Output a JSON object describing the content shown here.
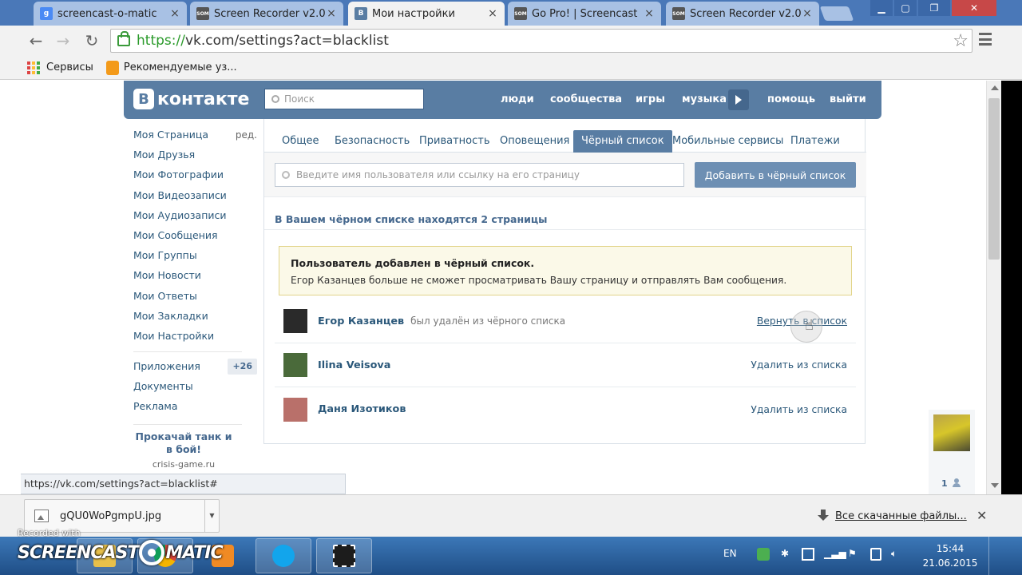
{
  "browser": {
    "tabs": [
      {
        "title": "screencast-o-matic",
        "favicon_color": "#4a8af4",
        "favicon_text": "g"
      },
      {
        "title": "Screen Recorder v2.0",
        "favicon_color": "#555555",
        "favicon_text": "SOM"
      },
      {
        "title": "Мои настройки",
        "favicon_color": "#597da3",
        "favicon_text": "B"
      },
      {
        "title": "Go Pro! | Screencast",
        "favicon_color": "#555555",
        "favicon_text": "SOM"
      },
      {
        "title": "Screen Recorder v2.0",
        "favicon_color": "#555555",
        "favicon_text": "SOM"
      }
    ],
    "url_scheme": "https://",
    "url_rest": "vk.com/settings?act=blacklist",
    "bookmarks": [
      "Сервисы",
      "Рекомендуемые уз..."
    ],
    "status_url": "https://vk.com/settings?act=blacklist#"
  },
  "vk": {
    "logo_text": "контакте",
    "search_placeholder": "Поиск",
    "nav": [
      "люди",
      "сообщества",
      "игры",
      "музыка",
      "помощь",
      "выйти"
    ],
    "left_menu": [
      "Моя Страница",
      "Мои Друзья",
      "Мои Фотографии",
      "Мои Видеозаписи",
      "Мои Аудиозаписи",
      "Мои Сообщения",
      "Мои Группы",
      "Мои Новости",
      "Мои Ответы",
      "Мои Закладки",
      "Мои Настройки"
    ],
    "edit_label": "ред.",
    "left_menu_extra": [
      "Приложения",
      "Документы",
      "Реклама"
    ],
    "apps_count": "+26",
    "promo_title": "Прокачай танк и в бой!",
    "promo_url": "crisis-game.ru",
    "settings_tabs": [
      "Общее",
      "Безопасность",
      "Приватность",
      "Оповещения",
      "Чёрный список",
      "Мобильные сервисы",
      "Платежи"
    ],
    "blacklist_placeholder": "Введите имя пользователя или ссылку на его страницу",
    "add_button": "Добавить в чёрный список",
    "count_text": "В Вашем чёрном списке находятся 2 страницы",
    "notice_title": "Пользователь добавлен в чёрный список.",
    "notice_text": "Егор Казанцев больше не сможет просматривать Вашу страницу и отправлять Вам сообщения.",
    "rows": [
      {
        "name": "Егор Казанцев",
        "sub": "был удалён из чёрного списка",
        "action": "Вернуть в список",
        "avatar": "#2a2a2a"
      },
      {
        "name": "Ilina Veisova",
        "sub": "",
        "action": "Удалить из списка",
        "avatar": "#4a6a3a"
      },
      {
        "name": "Даня Изотиков",
        "sub": "",
        "action": "Удалить из списка",
        "avatar": "#b9706a"
      }
    ],
    "mini_count": "1"
  },
  "downloads": {
    "file": "gQU0WoPgmpU.jpg",
    "all_label": "Все скачанные файлы..."
  },
  "taskbar": {
    "lang": "EN",
    "time": "15:44",
    "date": "21.06.2015",
    "rec_label": "Recorded with",
    "rec_brand_left": "SCREENCAST",
    "rec_brand_right": "MATIC"
  }
}
